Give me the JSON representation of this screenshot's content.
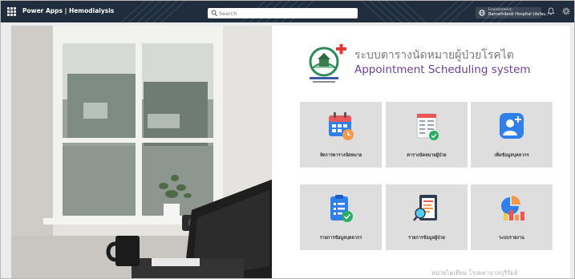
{
  "header": {
    "app_title": "Power Apps | Hemodialysis",
    "search_placeholder": "Search",
    "environment_label": "Environment",
    "environment_name": "Ramathibodi Hospital (defau..."
  },
  "app": {
    "title_th": "ระบบตารางนัดหมายผู้ป่วยโรคไต",
    "title_en": "Appointment Scheduling system",
    "footer": "หน่วยไตเทียม โรงพยาบาลบุรีรัมย์"
  },
  "tiles": [
    {
      "label": "จัดการตารางนัดหมาย",
      "icon": "calendar-icon"
    },
    {
      "label": "ตารางนัดหมายผู้ป่วย",
      "icon": "schedule-list-icon"
    },
    {
      "label": "เพิ่มข้อมูลบุคลากร",
      "icon": "add-user-icon"
    },
    {
      "label": "รายการข้อมูลบุคลากร",
      "icon": "staff-list-icon"
    },
    {
      "label": "รายการข้อมูลผู้ป่วย",
      "icon": "patient-list-icon"
    },
    {
      "label": "ระบบรายงาน",
      "icon": "report-chart-icon"
    }
  ],
  "colors": {
    "topbar": "#1f2d3d",
    "accent_purple": "#6b3fa0",
    "tile_bg": "#dedede",
    "icon_blue": "#2f80ed",
    "icon_orange": "#f2994a",
    "icon_green": "#27ae60"
  }
}
